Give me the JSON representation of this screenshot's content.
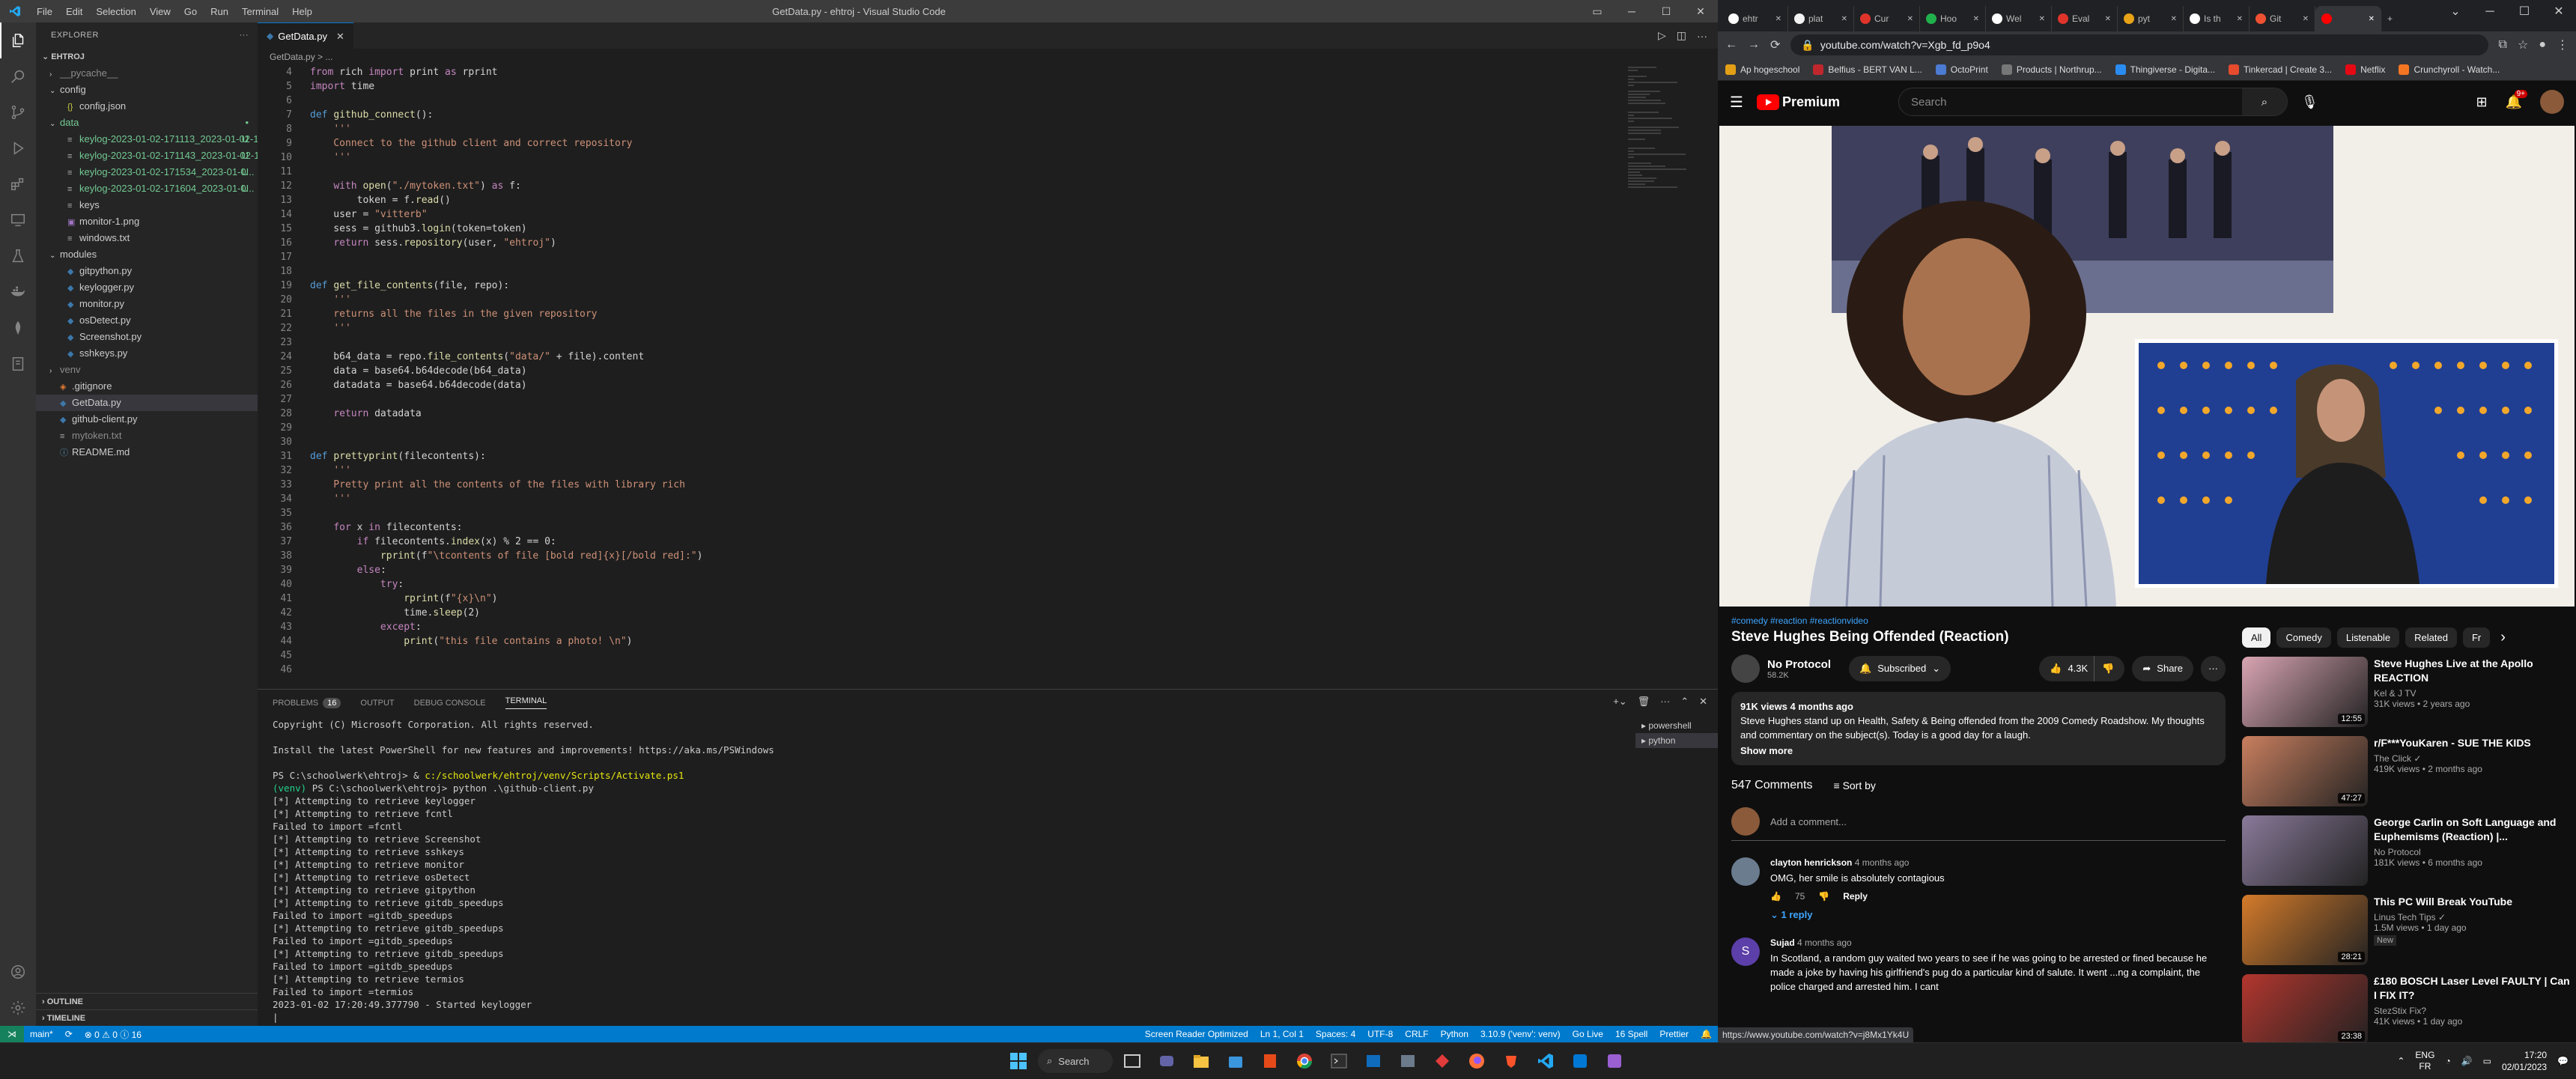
{
  "vscode": {
    "window_title": "GetData.py - ehtroj - Visual Studio Code",
    "menu": [
      "File",
      "Edit",
      "Selection",
      "View",
      "Go",
      "Run",
      "Terminal",
      "Help"
    ],
    "explorer_title": "EXPLORER",
    "root": "EHTROJ",
    "tree": [
      {
        "label": "__pycache__",
        "depth": 1,
        "type": "folder",
        "open": false,
        "style": "gray"
      },
      {
        "label": "config",
        "depth": 1,
        "type": "folder",
        "open": true,
        "style": ""
      },
      {
        "label": "config.json",
        "depth": 2,
        "type": "json",
        "style": ""
      },
      {
        "label": "data",
        "depth": 1,
        "type": "folder",
        "open": true,
        "style": "green",
        "badge": "•"
      },
      {
        "label": "keylog-2023-01-02-171113_2023-01-02-1...",
        "depth": 2,
        "type": "file",
        "style": "green",
        "badge": "U"
      },
      {
        "label": "keylog-2023-01-02-171143_2023-01-02-1...",
        "depth": 2,
        "type": "file",
        "style": "green",
        "badge": "U"
      },
      {
        "label": "keylog-2023-01-02-171534_2023-01-0...",
        "depth": 2,
        "type": "file",
        "style": "green",
        "badge": "U"
      },
      {
        "label": "keylog-2023-01-02-171604_2023-01-0...",
        "depth": 2,
        "type": "file",
        "style": "green",
        "badge": "U"
      },
      {
        "label": "keys",
        "depth": 2,
        "type": "file",
        "style": ""
      },
      {
        "label": "monitor-1.png",
        "depth": 2,
        "type": "image",
        "style": ""
      },
      {
        "label": "windows.txt",
        "depth": 2,
        "type": "txt",
        "style": ""
      },
      {
        "label": "modules",
        "depth": 1,
        "type": "folder",
        "open": true,
        "style": ""
      },
      {
        "label": "gitpython.py",
        "depth": 2,
        "type": "py",
        "style": ""
      },
      {
        "label": "keylogger.py",
        "depth": 2,
        "type": "py",
        "style": ""
      },
      {
        "label": "monitor.py",
        "depth": 2,
        "type": "py",
        "style": ""
      },
      {
        "label": "osDetect.py",
        "depth": 2,
        "type": "py",
        "style": ""
      },
      {
        "label": "Screenshot.py",
        "depth": 2,
        "type": "py",
        "style": ""
      },
      {
        "label": "sshkeys.py",
        "depth": 2,
        "type": "py",
        "style": ""
      },
      {
        "label": "venv",
        "depth": 1,
        "type": "folder",
        "open": false,
        "style": "gray"
      },
      {
        "label": ".gitignore",
        "depth": 1,
        "type": "git",
        "style": ""
      },
      {
        "label": "GetData.py",
        "depth": 1,
        "type": "py",
        "style": "",
        "selected": true
      },
      {
        "label": "github-client.py",
        "depth": 1,
        "type": "py",
        "style": ""
      },
      {
        "label": "mytoken.txt",
        "depth": 1,
        "type": "txt",
        "style": "gray"
      },
      {
        "label": "README.md",
        "depth": 1,
        "type": "md",
        "style": ""
      }
    ],
    "outline": "OUTLINE",
    "timeline": "TIMELINE",
    "tab": "GetData.py",
    "breadcrumb": "GetData.py > ...",
    "code": [
      {
        "n": "4",
        "t": "from rich import print as rprint"
      },
      {
        "n": "5",
        "t": "import time"
      },
      {
        "n": "6",
        "t": ""
      },
      {
        "n": "7",
        "t": "def github_connect():"
      },
      {
        "n": "8",
        "t": "    '''"
      },
      {
        "n": "9",
        "t": "    Connect to the github client and correct repository"
      },
      {
        "n": "10",
        "t": "    '''"
      },
      {
        "n": "11",
        "t": ""
      },
      {
        "n": "12",
        "t": "    with open(\"./mytoken.txt\") as f:"
      },
      {
        "n": "13",
        "t": "        token = f.read()"
      },
      {
        "n": "14",
        "t": "    user = \"vitterb\""
      },
      {
        "n": "15",
        "t": "    sess = github3.login(token=token)"
      },
      {
        "n": "16",
        "t": "    return sess.repository(user, \"ehtroj\")"
      },
      {
        "n": "17",
        "t": ""
      },
      {
        "n": "18",
        "t": ""
      },
      {
        "n": "19",
        "t": "def get_file_contents(file, repo):"
      },
      {
        "n": "20",
        "t": "    '''"
      },
      {
        "n": "21",
        "t": "    returns all the files in the given repository"
      },
      {
        "n": "22",
        "t": "    '''"
      },
      {
        "n": "23",
        "t": ""
      },
      {
        "n": "24",
        "t": "    b64_data = repo.file_contents(\"data/\" + file).content"
      },
      {
        "n": "25",
        "t": "    data = base64.b64decode(b64_data)"
      },
      {
        "n": "26",
        "t": "    datadata = base64.b64decode(data)"
      },
      {
        "n": "27",
        "t": ""
      },
      {
        "n": "28",
        "t": "    return datadata"
      },
      {
        "n": "29",
        "t": ""
      },
      {
        "n": "30",
        "t": ""
      },
      {
        "n": "31",
        "t": "def prettyprint(filecontents):"
      },
      {
        "n": "32",
        "t": "    '''"
      },
      {
        "n": "33",
        "t": "    Pretty print all the contents of the files with library rich"
      },
      {
        "n": "34",
        "t": "    '''"
      },
      {
        "n": "35",
        "t": ""
      },
      {
        "n": "36",
        "t": "    for x in filecontents:"
      },
      {
        "n": "37",
        "t": "        if filecontents.index(x) % 2 == 0:"
      },
      {
        "n": "38",
        "t": "            rprint(f\"\\tcontents of file [bold red]{x}[/bold red]:\")"
      },
      {
        "n": "39",
        "t": "        else:"
      },
      {
        "n": "40",
        "t": "            try:"
      },
      {
        "n": "41",
        "t": "                rprint(f\"{x}\\n\")"
      },
      {
        "n": "42",
        "t": "                time.sleep(2)"
      },
      {
        "n": "43",
        "t": "            except:"
      },
      {
        "n": "44",
        "t": "                print(\"this file contains a photo! \\n\")"
      },
      {
        "n": "45",
        "t": ""
      },
      {
        "n": "46",
        "t": ""
      }
    ],
    "panel_tabs": [
      "PROBLEMS",
      "OUTPUT",
      "DEBUG CONSOLE",
      "TERMINAL"
    ],
    "problems_count": "16",
    "terminal_lines": [
      "Copyright (C) Microsoft Corporation. All rights reserved.",
      "",
      "Install the latest PowerShell for new features and improvements! https://aka.ms/PSWindows",
      "",
      "PS C:\\schoolwerk\\ehtroj> & c:/schoolwerk/ehtroj/venv/Scripts/Activate.ps1",
      "(venv) PS C:\\schoolwerk\\ehtroj> python .\\github-client.py",
      "[*] Attempting to retrieve keylogger",
      "[*] Attempting to retrieve fcntl",
      "Failed to import =fcntl",
      "[*] Attempting to retrieve Screenshot",
      "[*] Attempting to retrieve sshkeys",
      "[*] Attempting to retrieve monitor",
      "[*] Attempting to retrieve osDetect",
      "[*] Attempting to retrieve gitpython",
      "[*] Attempting to retrieve gitdb_speedups",
      "Failed to import =gitdb_speedups",
      "[*] Attempting to retrieve gitdb_speedups",
      "Failed to import =gitdb_speedups",
      "[*] Attempting to retrieve gitdb_speedups",
      "Failed to import =gitdb_speedups",
      "[*] Attempting to retrieve termios",
      "Failed to import =termios",
      "2023-01-02 17:20:49.377790 - Started keylogger",
      "|"
    ],
    "terminals": [
      "powershell",
      "python"
    ],
    "status_left": [
      "main*",
      "⊗ 0 ⚠ 0 ⓘ 16"
    ],
    "status_right": [
      "Screen Reader Optimized",
      "Ln 1, Col 1",
      "Spaces: 4",
      "UTF-8",
      "CRLF",
      "Python",
      "3.10.9 ('venv': venv)",
      "Go Live",
      "16 Spell",
      "Prettier"
    ]
  },
  "browser": {
    "tabs": [
      {
        "label": "ehtr",
        "color": "#ffffff"
      },
      {
        "label": "plat",
        "color": "#f2f2f2"
      },
      {
        "label": "Cur",
        "color": "#e0342b"
      },
      {
        "label": "Hoo",
        "color": "#21b14c"
      },
      {
        "label": "Wel",
        "color": "#ffffff"
      },
      {
        "label": "Eval",
        "color": "#e0342b"
      },
      {
        "label": "pyt",
        "color": "#e8a317"
      },
      {
        "label": "Is th",
        "color": "#ffffff"
      },
      {
        "label": "Git",
        "color": "#f05133"
      },
      {
        "label": "",
        "color": "#ff0000",
        "active": true
      }
    ],
    "url": "youtube.com/watch?v=Xgb_fd_p9o4",
    "bookmarks": [
      {
        "label": "Ap hogeschool",
        "color": "#e3a016"
      },
      {
        "label": "Belfius - BERT VAN L...",
        "color": "#c0272d"
      },
      {
        "label": "OctoPrint",
        "color": "#4b7bd3"
      },
      {
        "label": "Products | Northrup...",
        "color": "#777777"
      },
      {
        "label": "Thingiverse - Digita...",
        "color": "#2a8cf0"
      },
      {
        "label": "Tinkercad | Create 3...",
        "color": "#e64b2e"
      },
      {
        "label": "Netflix",
        "color": "#e50914"
      },
      {
        "label": "Crunchyroll - Watch...",
        "color": "#f47521"
      }
    ],
    "yt": {
      "logo": "Premium",
      "search_placeholder": "Search",
      "notif": "9+",
      "tags": "#comedy #reaction #reactionvideo",
      "title": "Steve Hughes Being Offended (Reaction)",
      "channel": "No Protocol",
      "subs": "58.2K",
      "subscribed": "Subscribed",
      "likes": "4.3K",
      "share": "Share",
      "views": "91K views  4 months ago",
      "description": "Steve Hughes stand up on Health, Safety & Being offended from the 2009 Comedy Roadshow. My thoughts and commentary on the subject(s). Today is a good day for a laugh.",
      "show_more": "Show more",
      "comments_count": "547 Comments",
      "sort": "Sort by",
      "add_comment": "Add a comment...",
      "comments": [
        {
          "author": "clayton henrickson",
          "time": "4 months ago",
          "text": "OMG, her smile is absolutely contagious",
          "likes": "75",
          "reply": "Reply",
          "replies": "1 reply",
          "color": "#6b7c8f"
        },
        {
          "author": "Sujad",
          "time": "4 months ago",
          "text": "In Scotland, a random guy waited two years to see if he was going to be arrested or fined because he made a joke by having his girlfriend's pug do a particular kind of salute. It went ...ng a complaint, the police charged and arrested him. I cant",
          "likes": "",
          "reply": "",
          "replies": "",
          "color": "#5c3fa8",
          "initial": "S"
        }
      ],
      "chips": [
        "All",
        "Comedy",
        "Listenable",
        "Related",
        "Fr"
      ],
      "recs": [
        {
          "title": "Steve Hughes Live at the Apollo REACTION",
          "channel": "Kel & J TV",
          "meta": "31K views • 2 years ago",
          "dur": "12:55",
          "new": "",
          "color": "#d9a5b3"
        },
        {
          "title": "r/F***YouKaren - SUE THE KIDS",
          "channel": "The Click ✓",
          "meta": "419K views • 2 months ago",
          "dur": "47:27",
          "new": "",
          "color": "#c97f5f"
        },
        {
          "title": "George Carlin on Soft Language and Euphemisms (Reaction) |...",
          "channel": "No Protocol",
          "meta": "181K views • 6 months ago",
          "dur": "",
          "new": "",
          "color": "#8a7a9a"
        },
        {
          "title": "This PC Will Break YouTube",
          "channel": "Linus Tech Tips ✓",
          "meta": "1.5M views • 1 day ago",
          "dur": "28:21",
          "new": "New",
          "color": "#d47b2a"
        },
        {
          "title": "£180 BOSCH Laser Level FAULTY | Can I FIX IT?",
          "channel": "StezStix Fix?",
          "meta": "41K views • 1 day ago",
          "dur": "23:38",
          "new": "",
          "color": "#b3362e"
        }
      ],
      "hover_url": "https://www.youtube.com/watch?v=j8Mx1Yk4U"
    }
  },
  "taskbar": {
    "search": "Search",
    "lang": "ENG",
    "region": "FR",
    "time": "17:20",
    "date": "02/01/2023"
  }
}
